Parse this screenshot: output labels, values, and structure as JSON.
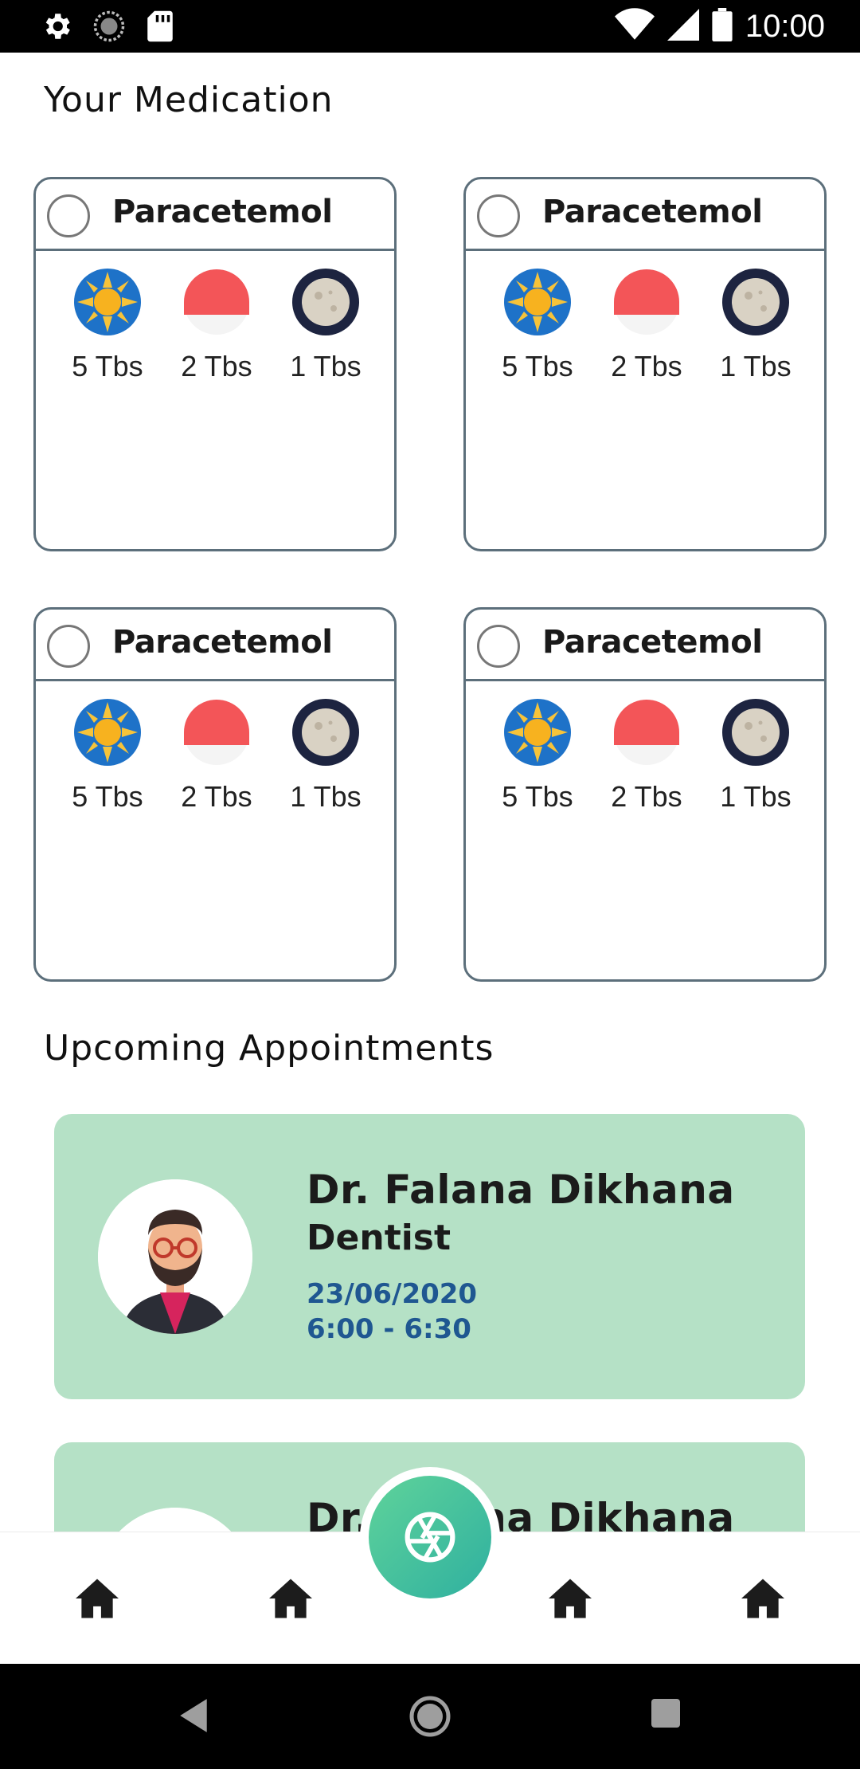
{
  "status_bar": {
    "time": "10:00",
    "left_icons": [
      "settings-icon",
      "sync-icon",
      "sd-card-icon"
    ],
    "right_icons": [
      "wifi-icon",
      "cell-signal-icon",
      "battery-icon"
    ]
  },
  "medication": {
    "title": "Your Medication",
    "cards": [
      {
        "name": "Paracetemol",
        "doses": [
          {
            "icon": "sun-icon",
            "label": "5 Tbs"
          },
          {
            "icon": "sunset-icon",
            "label": "2 Tbs"
          },
          {
            "icon": "moon-icon",
            "label": "1 Tbs"
          }
        ]
      },
      {
        "name": "Paracetemol",
        "doses": [
          {
            "icon": "sun-icon",
            "label": "5 Tbs"
          },
          {
            "icon": "sunset-icon",
            "label": "2 Tbs"
          },
          {
            "icon": "moon-icon",
            "label": "1 Tbs"
          }
        ]
      },
      {
        "name": "Paracetemol",
        "doses": [
          {
            "icon": "sun-icon",
            "label": "5 Tbs"
          },
          {
            "icon": "sunset-icon",
            "label": "2 Tbs"
          },
          {
            "icon": "moon-icon",
            "label": "1 Tbs"
          }
        ]
      },
      {
        "name": "Paracetemol",
        "doses": [
          {
            "icon": "sun-icon",
            "label": "5 Tbs"
          },
          {
            "icon": "sunset-icon",
            "label": "2 Tbs"
          },
          {
            "icon": "moon-icon",
            "label": "1 Tbs"
          }
        ]
      }
    ]
  },
  "appointments": {
    "title": "Upcoming Appointments",
    "items": [
      {
        "doctor": "Dr. Falana Dikhana",
        "specialty": "Dentist",
        "date": "23/06/2020",
        "time": "6:00 - 6:30"
      },
      {
        "doctor": "Dr. Falana Dikhana",
        "specialty": "",
        "date": "",
        "time": ""
      }
    ]
  },
  "bottom_nav": {
    "items": [
      "home-icon",
      "home-icon",
      "home-icon",
      "home-icon"
    ],
    "fab_icon": "camera-shutter-icon"
  },
  "system_nav": [
    "back-icon",
    "home-circle-icon",
    "recents-icon"
  ],
  "colors": {
    "card_border": "#5c6f7b",
    "appointment_bg": "#b5e1c6",
    "date_text": "#1f5791",
    "fab_gradient_start": "#5fd39a",
    "fab_gradient_end": "#2fb0a0"
  }
}
